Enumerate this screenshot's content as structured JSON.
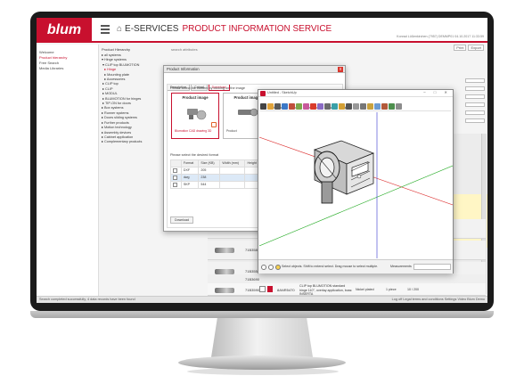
{
  "app": {
    "logo": "blum",
    "home_label": "E-SERVICES",
    "section_title": "PRODUCT INFORMATION SERVICE",
    "user_info": "Konrad Lüßenkirchen (7957) DEMMP01  04.10.2017 11:33:59",
    "tools": [
      "Print",
      "Export"
    ]
  },
  "left_nav": {
    "items": [
      "Welcome",
      "Product hierarchy",
      "Free Search",
      "Media Libraries"
    ]
  },
  "main": {
    "tree_header": "Product Hierarchy",
    "search_label": "search attributes",
    "tree_items": [
      "all systems",
      "Hinge systems",
      "CLIP top BLUMOTION",
      "Hinge",
      "Mounting plate",
      "Accessories",
      "CLIP top",
      "CLIP",
      "MODUL",
      "BLUMOTION for hinges",
      "TIP-ON for doors",
      "Box systems",
      "Runner systems",
      "Doors sliding systems",
      "Further products",
      "Motion technology",
      "Assembly devices",
      "Cabinet application",
      "Complementary products"
    ],
    "rows": [
      {
        "code": "71B3590"
      },
      {
        "code": "71B3580"
      },
      {
        "code": "71B3550"
      },
      {
        "code": "71B3690"
      },
      {
        "code": "71B3590",
        "article": "8ANR5470",
        "description": "CLIP top BLUMOTION standard hinge 110°, overlay application, boss: INSERTA",
        "finish": "Nickel plated",
        "quantity": "1 piece",
        "unit": "10 / 200"
      }
    ]
  },
  "status_bar": {
    "left": "Search completed successfully, 4 data records have been found",
    "right": "Log off  Legal terms and conditions  Settings  Video Blum Demo"
  },
  "dialog": {
    "title": "Product Information",
    "tabs": [
      "Description",
      "Cabad",
      "Download"
    ],
    "selected_tab": "Download",
    "instruction_content": "Please select the content by clicking on the image",
    "cards": [
      {
        "title": "Product image",
        "caption": "Blumotion CAD drawing 3D",
        "selected": true
      },
      {
        "title": "Product image",
        "caption": "Product",
        "selected": false
      }
    ],
    "instruction_format": "Please select the desired format",
    "format_headers": [
      "",
      "Format",
      "Size (KB)",
      "Width (mm)",
      "Height (mm)"
    ],
    "formats": [
      {
        "format": "DXF",
        "size": "205",
        "selected": false
      },
      {
        "format": "dwg",
        "size": "238",
        "selected": true
      },
      {
        "format": "SKP",
        "size": "544",
        "selected": false
      }
    ],
    "close_label": "x",
    "button_label": "Download"
  },
  "viewer": {
    "title": "Untitled - SketchUp",
    "menu": [
      "File",
      "Edit",
      "View",
      "Camera",
      "Draw",
      "Tools",
      "Window",
      "Help"
    ],
    "status_message": "Select objects. Shift to extend select. Drag mouse to select multiple.",
    "measurements_label": "Measurements",
    "window_buttons": "–  □  ✕"
  },
  "colors": {
    "brand": "#c8102e",
    "axis_red": "#d33",
    "axis_green": "#2a2",
    "axis_blue": "#33c"
  }
}
